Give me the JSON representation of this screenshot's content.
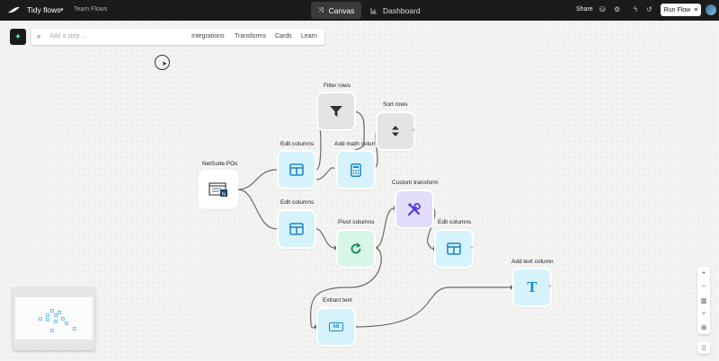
{
  "header": {
    "flow_name": "Tidy flows",
    "team": "Team Flows",
    "tabs": [
      {
        "label": "Canvas",
        "icon": "canvas-icon"
      },
      {
        "label": "Dashboard",
        "icon": "chart-icon"
      }
    ],
    "share_label": "Share",
    "run_label": "Run Flow"
  },
  "toolbar": {
    "placeholder": "Add a step ...",
    "items": [
      "Integrations",
      "Transforms",
      "Cards",
      "Learn"
    ]
  },
  "nodes": [
    {
      "label": "NetSuite POs",
      "icon": "netsuite-icon"
    },
    {
      "label": "Edit columns",
      "icon": "columns-icon"
    },
    {
      "label": "Filter rows",
      "icon": "filter-icon"
    },
    {
      "label": "Add math column",
      "icon": "calculator-icon"
    },
    {
      "label": "Sort rows",
      "icon": "sort-icon"
    },
    {
      "label": "Edit columns",
      "icon": "columns-icon"
    },
    {
      "label": "Pivot columns",
      "icon": "refresh-icon"
    },
    {
      "label": "Custom transform",
      "icon": "tools-icon"
    },
    {
      "label": "Edit columns",
      "icon": "columns-icon"
    },
    {
      "label": "Extract text",
      "icon": "extract-text-icon"
    },
    {
      "label": "Add text column",
      "icon": "text-icon"
    }
  ],
  "extract_badge": "AB",
  "text_glyph": "T",
  "colors": {
    "topbar": "#1b1b1b",
    "columns_node": "#d6f3fb",
    "filter_node": "#e4e4e4",
    "pivot_node": "#d8f6e6",
    "custom_node": "#e3dcfb",
    "accent_blue": "#1f86c9",
    "accent_green": "#0f8a52",
    "accent_purple": "#4f3fd6"
  }
}
